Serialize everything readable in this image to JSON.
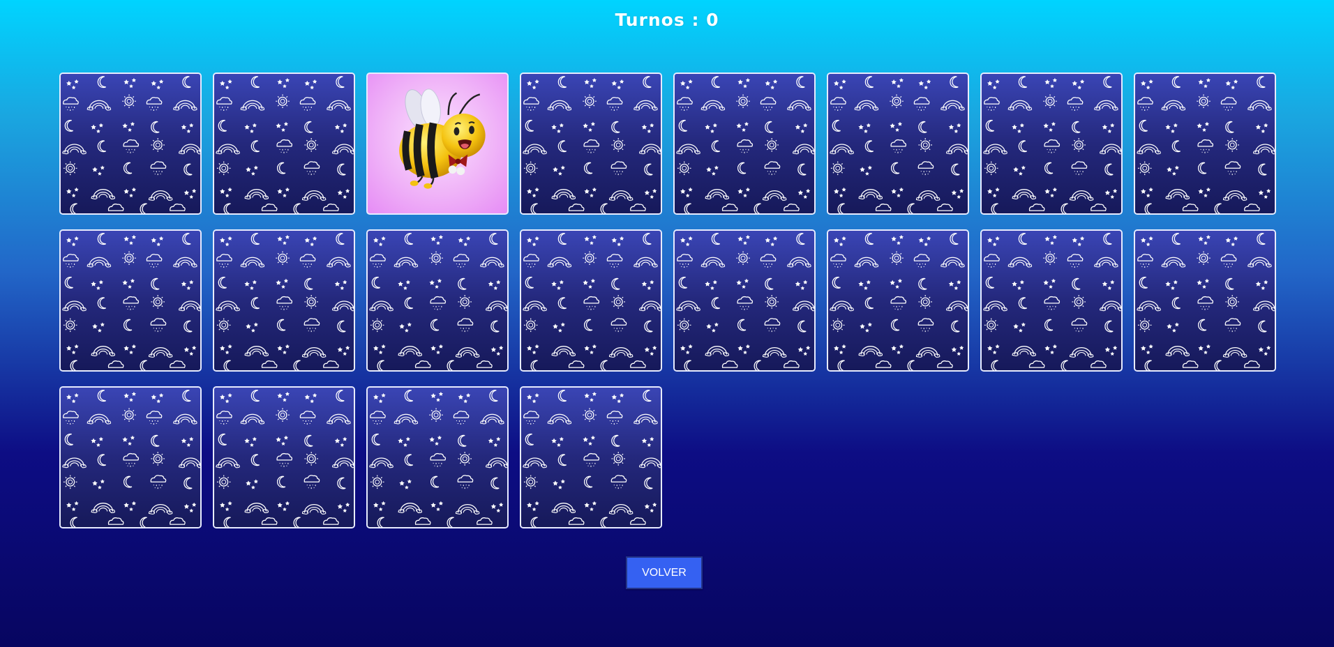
{
  "header": {
    "turns_label": "Turnos : 0"
  },
  "board": {
    "cards": [
      {
        "state": "face-down"
      },
      {
        "state": "face-down"
      },
      {
        "state": "face-up",
        "face_icon": "bee-icon"
      },
      {
        "state": "face-down"
      },
      {
        "state": "face-down"
      },
      {
        "state": "face-down"
      },
      {
        "state": "face-down"
      },
      {
        "state": "face-down"
      },
      {
        "state": "face-down"
      },
      {
        "state": "face-down"
      },
      {
        "state": "face-down"
      },
      {
        "state": "face-down"
      },
      {
        "state": "face-down"
      },
      {
        "state": "face-down"
      },
      {
        "state": "face-down"
      },
      {
        "state": "face-down"
      },
      {
        "state": "face-down"
      },
      {
        "state": "face-down"
      },
      {
        "state": "face-down"
      },
      {
        "state": "face-down"
      }
    ],
    "card_back_icon": "weather-pattern-icon"
  },
  "footer": {
    "back_button_label": "VOLVER"
  },
  "colors": {
    "button_bg": "#3561f2",
    "card_border": "#e8ecff",
    "card_back_top": "#3a45b5",
    "card_back_bottom": "#16195a",
    "flipped_card_bg": "#f0b4f8"
  }
}
